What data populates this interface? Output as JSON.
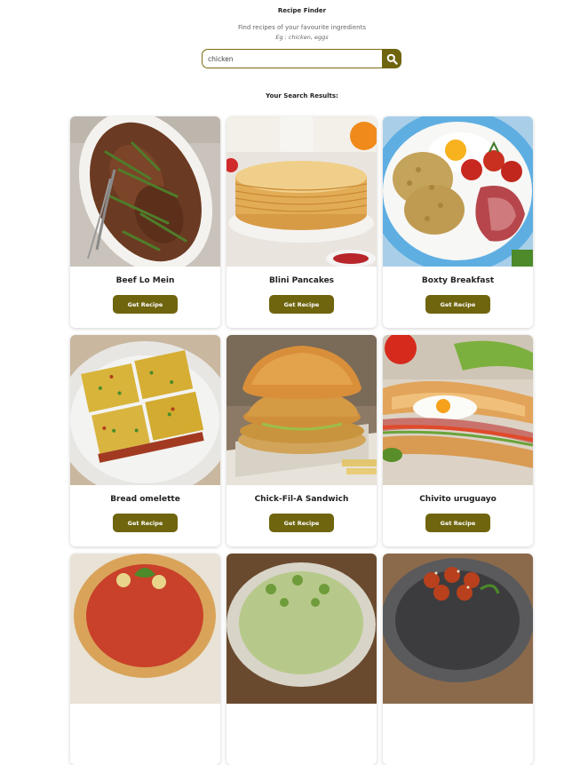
{
  "header": {
    "title": "Recipe Finder",
    "subtitle": "Find recipes of your favourite ingredients",
    "example": "Eg : chicken, eggs"
  },
  "search": {
    "value": "chicken",
    "button_icon": "search-icon"
  },
  "results": {
    "heading": "Your Search Results:",
    "button_label": "Get Recipe",
    "recipes": [
      {
        "name": "Beef Lo Mein"
      },
      {
        "name": "Blini Pancakes"
      },
      {
        "name": "Boxty Breakfast"
      },
      {
        "name": "Bread omelette"
      },
      {
        "name": "Chick-Fil-A Sandwich"
      },
      {
        "name": "Chivito uruguayo"
      },
      {
        "name": ""
      },
      {
        "name": ""
      },
      {
        "name": ""
      }
    ]
  },
  "colors": {
    "accent": "#6f650e",
    "card_shadow": "rgba(0,0,0,0.18)"
  }
}
